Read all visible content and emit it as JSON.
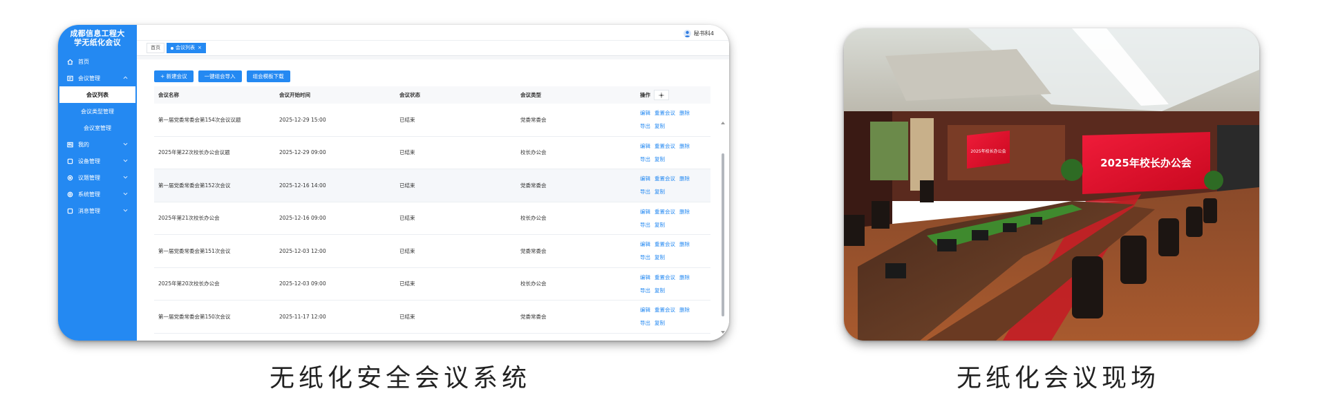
{
  "left_panel": {
    "brand": [
      "成都信息工程大",
      "学无纸化会议"
    ],
    "menu": [
      {
        "icon": "home-icon",
        "label": "首页",
        "chevron": false
      },
      {
        "icon": "meeting-icon",
        "label": "会议管理",
        "chevron": "up"
      },
      {
        "icon": "user-icon",
        "label": "我的",
        "chevron": "down"
      },
      {
        "icon": "device-icon",
        "label": "设备管理",
        "chevron": "down"
      },
      {
        "icon": "topic-icon",
        "label": "议题管理",
        "chevron": "down"
      },
      {
        "icon": "settings-icon",
        "label": "系统管理",
        "chevron": "down"
      },
      {
        "icon": "message-icon",
        "label": "消息管理",
        "chevron": "down"
      }
    ],
    "submenu": [
      "会议列表",
      "会议类型管理",
      "会议室管理"
    ],
    "user_name": "秘书科4",
    "tabs": {
      "home": "首页",
      "active": "会议列表",
      "close": "×"
    },
    "toolbar": {
      "new": "+ 新建会议",
      "import": "一键组会导入",
      "template": "组会模板下载"
    },
    "table": {
      "headers": [
        "会议名称",
        "会议开始时间",
        "会议状态",
        "会议类型",
        "操作"
      ],
      "ops": [
        "编辑",
        "重置会议",
        "删除",
        "导出",
        "复制"
      ],
      "rows": [
        {
          "name": "第一届党委常委会第154次会议议题",
          "time": "2025-12-29 15:00",
          "status": "已结束",
          "type": "党委常委会"
        },
        {
          "name": "2025年第22次校长办公会议题",
          "time": "2025-12-29 09:00",
          "status": "已结束",
          "type": "校长办公会"
        },
        {
          "name": "第一届党委常委会第152次会议",
          "time": "2025-12-16 14:00",
          "status": "已结束",
          "type": "党委常委会"
        },
        {
          "name": "2025年第21次校长办公会",
          "time": "2025-12-16 09:00",
          "status": "已结束",
          "type": "校长办公会"
        },
        {
          "name": "第一届党委常委会第151次会议",
          "time": "2025-12-03 12:00",
          "status": "已结束",
          "type": "党委常委会"
        },
        {
          "name": "2025年第20次校长办公会",
          "time": "2025-12-03 09:00",
          "status": "已结束",
          "type": "校长办公会"
        },
        {
          "name": "第一届党委常委会第150次会议",
          "time": "2025-11-17 12:00",
          "status": "已结束",
          "type": "党委常委会"
        }
      ]
    }
  },
  "right_panel": {
    "screen_text": "2025年校长办公会",
    "side_screen_text": "2025年校长办公会"
  },
  "captions": {
    "left": "无纸化安全会议系统",
    "right": "无纸化会议现场"
  },
  "colors": {
    "accent": "#2489f2",
    "screen_red": "#e2102c"
  }
}
